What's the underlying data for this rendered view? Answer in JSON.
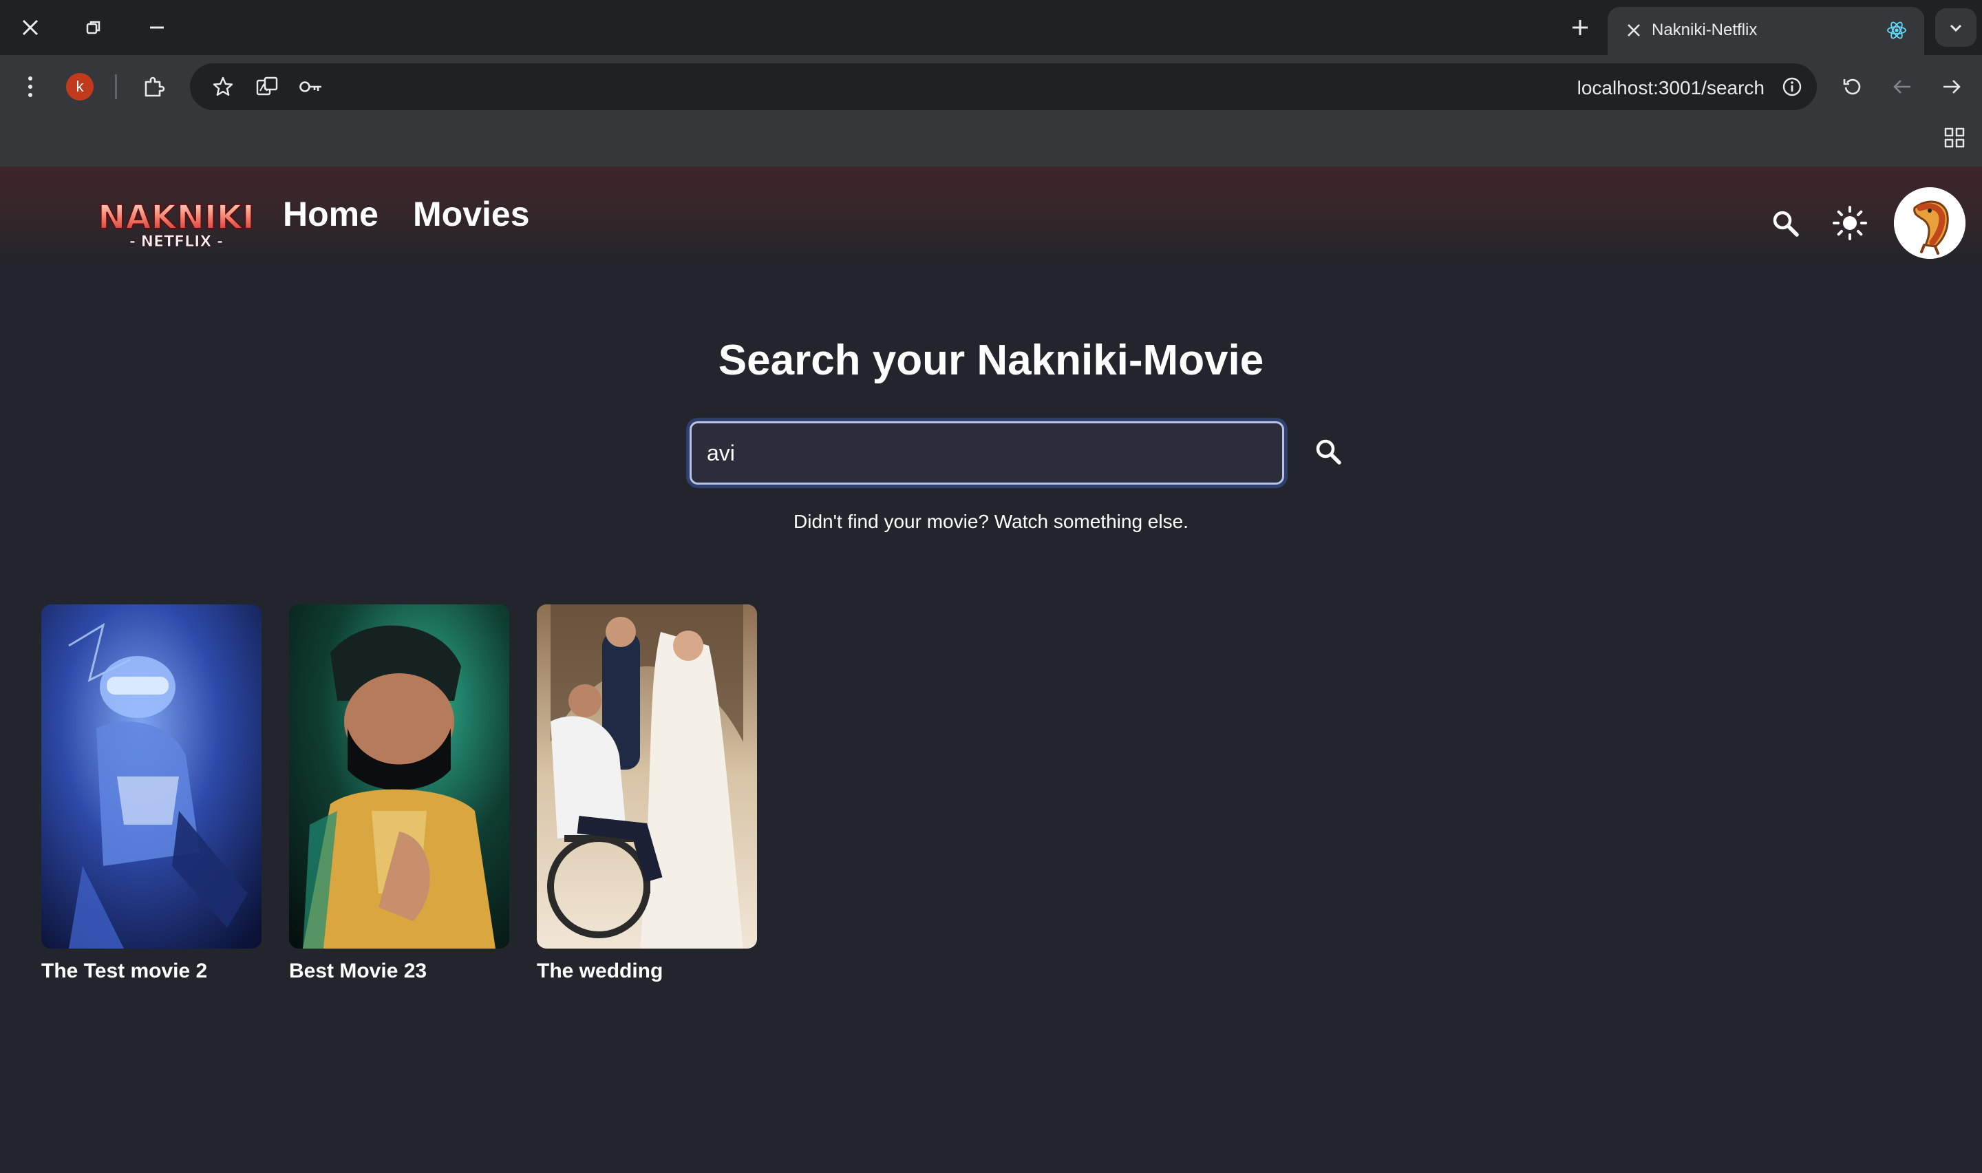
{
  "browser": {
    "tab_title": "Nakniki-Netflix",
    "url": "localhost:3001/search",
    "profile_initial": "k"
  },
  "header": {
    "logo_main": "NAKNIKI",
    "logo_sub": "- NETFLIX -",
    "nav": [
      {
        "label": "Home"
      },
      {
        "label": "Movies"
      }
    ]
  },
  "search": {
    "title": "Search your Nakniki-Movie",
    "query": "avi",
    "hint": "Didn't find your movie? Watch something else."
  },
  "results": [
    {
      "title": "The Test movie 2"
    },
    {
      "title": "Best Movie 23"
    },
    {
      "title": "The wedding"
    }
  ],
  "colors": {
    "page_bg": "#22252b",
    "header_tint": "#3e2529",
    "input_border": "#b8c3e6"
  }
}
